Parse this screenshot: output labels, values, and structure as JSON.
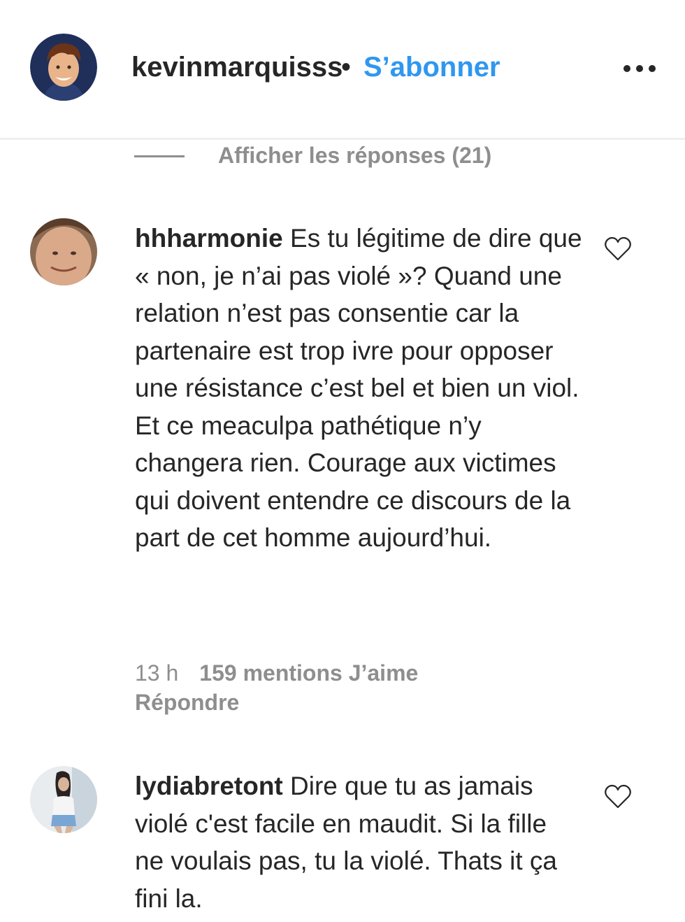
{
  "post_header": {
    "username": "kevinmarquisss",
    "separator": "•",
    "follow_label": "S’abonner",
    "more_icon": "more-horizontal-icon"
  },
  "view_replies_label": "Afficher les réponses (21)",
  "comments": [
    {
      "author": "hhharmonie",
      "text": "Es tu légitime de dire que « non, je n’ai pas violé »? Quand une relation n’est pas consentie car la partenaire est trop ivre pour opposer une résistance c’est bel et bien un viol. Et ce meaculpa pathétique n’y changera rien. Courage aux victimes qui doivent entendre ce discours de la part de cet homme aujourd’hui.",
      "time": "13 h",
      "likes": "159 mentions J’aime",
      "reply_label": "Répondre",
      "like_icon": "heart-outline-icon"
    },
    {
      "author": "lydiabretont",
      "text": "Dire que tu as jamais violé c'est facile en maudit. Si la fille ne voulais pas, tu la violé. Thats it ça fini la.",
      "like_icon": "heart-outline-icon"
    }
  ],
  "colors": {
    "link_blue": "#2f97f0",
    "text": "#262626",
    "muted": "#8e8e8e",
    "divider": "#efefef"
  }
}
